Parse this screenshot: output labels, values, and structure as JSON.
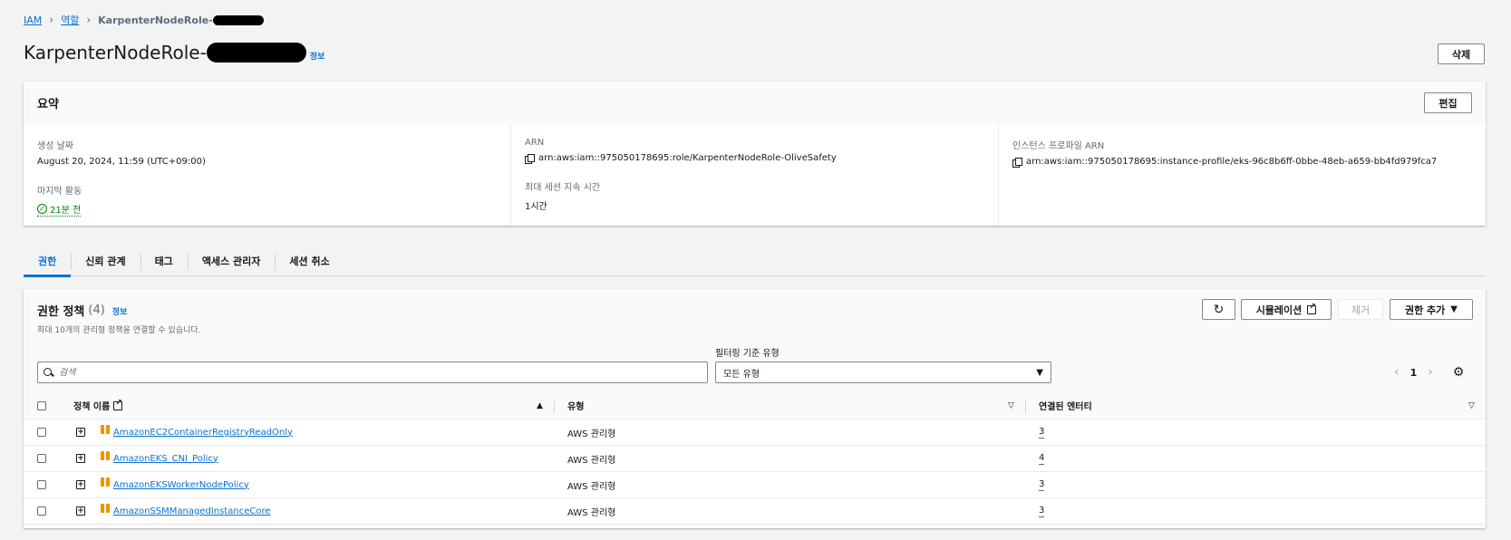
{
  "breadcrumb": {
    "items": [
      "IAM",
      "역할"
    ],
    "current": "KarpenterNodeRole-"
  },
  "page": {
    "title": "KarpenterNodeRole-",
    "info": "정보",
    "delete_label": "삭제"
  },
  "summary": {
    "title": "요약",
    "edit_label": "편집",
    "created_label": "생성 날짜",
    "created_value": "August 20, 2024, 11:59 (UTC+09:00)",
    "last_activity_label": "마지막 활동",
    "last_activity_value": "21분 전",
    "arn_label": "ARN",
    "arn_value": "arn:aws:iam::975050178695:role/KarpenterNodeRole-OliveSafety",
    "max_session_label": "최대 세션 지속 시간",
    "max_session_value": "1시간",
    "instance_profile_label": "인스턴스 프로파일 ARN",
    "instance_profile_value": "arn:aws:iam::975050178695:instance-profile/eks-96c8b6ff-0bbe-48eb-a659-bb4fd979fca7"
  },
  "tabs": [
    "권한",
    "신뢰 관계",
    "태그",
    "액세스 관리자",
    "세션 취소"
  ],
  "permissions": {
    "title": "권한 정책",
    "count": "(4)",
    "info": "정보",
    "description": "최대 10개의 관리형 정책을 연결할 수 있습니다.",
    "simulate_label": "시뮬레이션",
    "remove_label": "제거",
    "add_label": "권한 추가",
    "filter_label": "필터링 기준 유형",
    "search_placeholder": "검색",
    "filter_value": "모든 유형",
    "page_number": "1",
    "columns": {
      "name": "정책 이름",
      "type": "유형",
      "entities": "연결된 엔터티"
    },
    "rows": [
      {
        "name": "AmazonEC2ContainerRegistryReadOnly",
        "type": "AWS 관리형",
        "entities": "3"
      },
      {
        "name": "AmazonEKS_CNI_Policy",
        "type": "AWS 관리형",
        "entities": "4"
      },
      {
        "name": "AmazonEKSWorkerNodePolicy",
        "type": "AWS 관리형",
        "entities": "3"
      },
      {
        "name": "AmazonSSMManagedInstanceCore",
        "type": "AWS 관리형",
        "entities": "3"
      }
    ]
  },
  "icons": {
    "copy": "copy-icon",
    "check": "check-circle-icon",
    "refresh": "refresh-icon",
    "external": "external-link-icon",
    "search": "search-icon",
    "settings": "gear-icon",
    "expand": "expand-icon",
    "package": "managed-policy-icon"
  },
  "colors": {
    "link": "#0972d3",
    "success": "#037f0c",
    "policy_icon": "#f29100"
  }
}
